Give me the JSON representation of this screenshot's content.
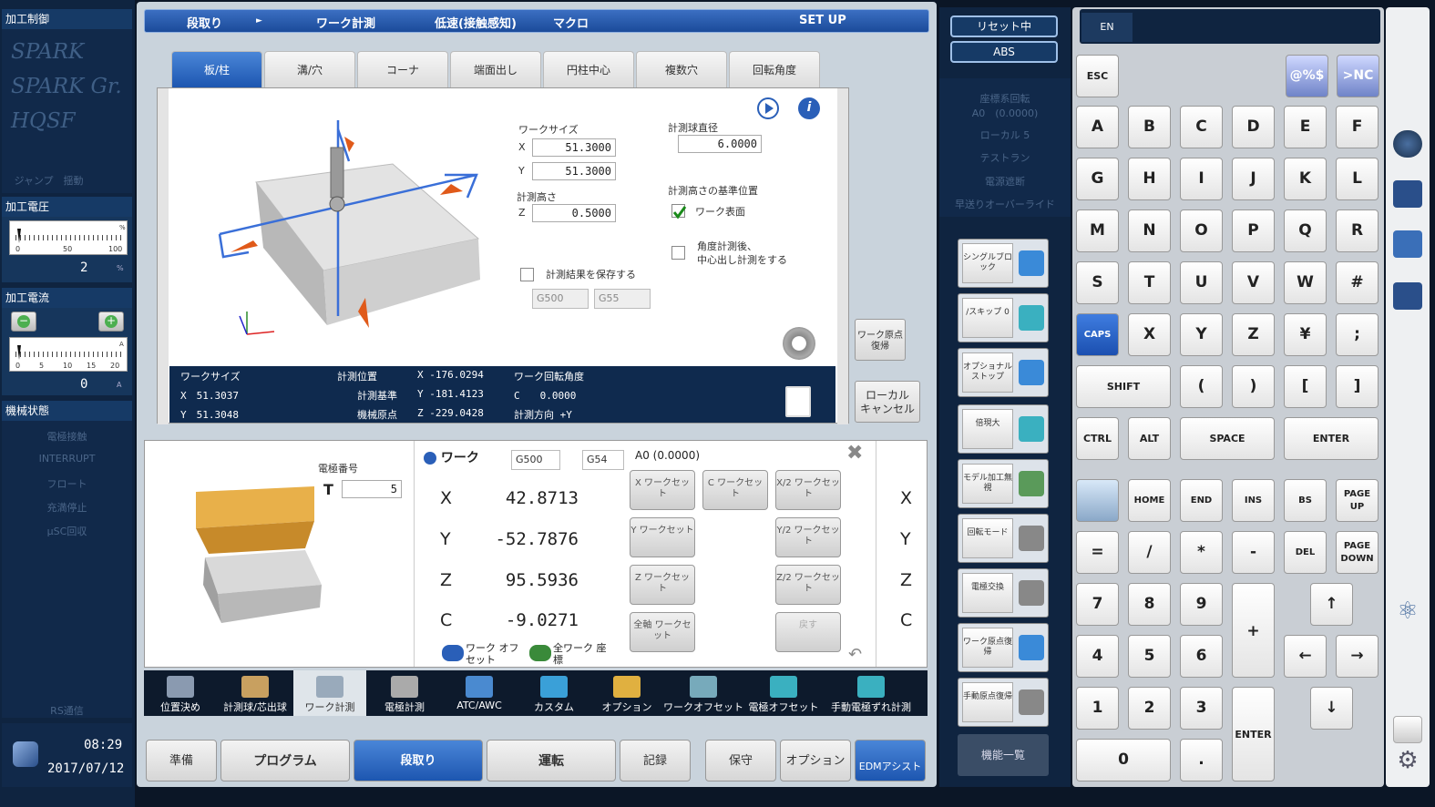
{
  "left": {
    "header1": "加工制御",
    "sparks": [
      "SPARK",
      "SPARK Gr.",
      "HQSF"
    ],
    "jump": "ジャンプ　揺動",
    "voltage_title": "加工電圧",
    "voltage_ticks": [
      "0",
      "50",
      "100"
    ],
    "voltage_unit_top": "%",
    "voltage_value": "2",
    "voltage_unit": "%",
    "current_title": "加工電流",
    "current_ticks": [
      "0",
      "5",
      "10",
      "15",
      "20"
    ],
    "current_unit_top": "A",
    "current_value": "0",
    "current_unit": "A",
    "machine_title": "機械状態",
    "machine_items": [
      "電極接触",
      "INTERRUPT",
      "フロート",
      "充満停止",
      "μSC回収"
    ],
    "rs": "RS通信",
    "time": "08:29",
    "date": "2017/07/12"
  },
  "topbar": {
    "item1": "段取り",
    "arrow": "►",
    "item2": "ワーク計測",
    "item3": "低速(接触感知)",
    "item4": "マクロ",
    "item5": "SET UP"
  },
  "tabs": [
    "板/柱",
    "溝/穴",
    "コーナ",
    "端面出し",
    "円柱中心",
    "複数穴",
    "回転角度"
  ],
  "form": {
    "work_size_label": "ワークサイズ",
    "x_label": "X",
    "x_value": "51.3000",
    "y_label": "Y",
    "y_value": "51.3000",
    "height_label": "計測高さ",
    "z_label": "Z",
    "z_value": "0.5000",
    "ball_label": "計測球直径",
    "ball_value": "6.0000",
    "ref_label": "計測高さの基準位置",
    "ref_check": "ワーク表面",
    "angle_check_1": "角度計測後、",
    "angle_check_2": "中心出し計測をする",
    "save_check": "計測結果を保存する",
    "sel1": "G500",
    "sel2": "G55"
  },
  "status": {
    "work_size": "ワークサイズ",
    "x": "X　51.3037",
    "y": "Y　51.3048",
    "pos_label": "計測位置",
    "base_label": "計測基準",
    "origin_label": "機械原点",
    "px": "X -176.0294",
    "py": "Y -181.4123",
    "pz": "Z -229.0428",
    "angle_label": "ワーク回転角度",
    "c": "C　　0.0000",
    "dir": "計測方向 +Y"
  },
  "side_buttons": {
    "origin_return": "ワーク原点復帰",
    "local_cancel_1": "ローカル",
    "local_cancel_2": "キャンセル"
  },
  "lower": {
    "electrode_label": "電極番号",
    "t_label": "T",
    "t_value": "5",
    "work_title": "ワーク",
    "sel_a": "G500",
    "sel_b": "G54",
    "a0": "A0 (0.0000)",
    "axes": [
      {
        "name": "X",
        "value": "42.8713"
      },
      {
        "name": "Y",
        "value": "-52.7876"
      },
      {
        "name": "Z",
        "value": "95.5936"
      },
      {
        "name": "C",
        "value": "-9.0271"
      }
    ],
    "btns": [
      "X ワークセット",
      "C ワークセット",
      "X/2 ワークセット",
      "Y ワークセット",
      "Y/2 ワークセット",
      "Z ワークセット",
      "Z/2 ワークセット",
      "全軸 ワークセット",
      "戻す"
    ],
    "offset_label": "ワーク オフセット",
    "all_work_label": "全ワーク 座標",
    "right_axes": [
      "X",
      "Y",
      "Z",
      "C"
    ]
  },
  "iconbar": [
    "位置決め",
    "計測球/芯出球",
    "ワーク計測",
    "電極計測",
    "ATC/AWC",
    "カスタム",
    "オプション",
    "ワークオフセット",
    "電極オフセット",
    "手動電極ずれ計測"
  ],
  "bottombar": [
    "準備",
    "プログラム",
    "段取り",
    "運転",
    "記録",
    "保守",
    "オプション",
    "EDMアシスト"
  ],
  "ctrl": {
    "reset": "リセット中",
    "abs": "ABS",
    "info": [
      "座標系回転",
      "A0　(0.0000)",
      "ローカル 5",
      "テストラン",
      "電源遮断",
      "早送りオーバーライド"
    ],
    "funcs": [
      "シングルブロック",
      "/スキップ 0",
      "オプショナルストップ",
      "倍現大",
      "モデル加工無視",
      "回転モード",
      "電極交換",
      "ワーク原点復帰",
      "手動原点復帰"
    ],
    "func_list": "機能一覧"
  },
  "kbd": {
    "lang": "EN",
    "esc": "ESC",
    "sym": "@%$",
    "nc": ">NC",
    "row1": [
      "A",
      "B",
      "C",
      "D",
      "E",
      "F"
    ],
    "row2": [
      "G",
      "H",
      "I",
      "J",
      "K",
      "L"
    ],
    "row3": [
      "M",
      "N",
      "O",
      "P",
      "Q",
      "R"
    ],
    "row4": [
      "S",
      "T",
      "U",
      "V",
      "W",
      "#"
    ],
    "row5": [
      "CAPS",
      "X",
      "Y",
      "Z",
      "¥",
      ";"
    ],
    "shift": "SHIFT",
    "row6": [
      "(",
      ")",
      "[",
      "]"
    ],
    "ctrl": "CTRL",
    "alt": "ALT",
    "space": "SPACE",
    "enter": "ENTER",
    "row8": [
      "HOME",
      "END",
      "INS",
      "BS",
      "PAGE UP"
    ],
    "row9": [
      "=",
      "/",
      "*",
      "-",
      "DEL",
      "PAGE DOWN"
    ],
    "nums": [
      "7",
      "8",
      "9",
      "4",
      "5",
      "6",
      "1",
      "2",
      "3",
      "0",
      "."
    ],
    "plus": "+",
    "enter2": "ENTER",
    "up": "↑",
    "left": "←",
    "right": "→",
    "down": "↓"
  }
}
